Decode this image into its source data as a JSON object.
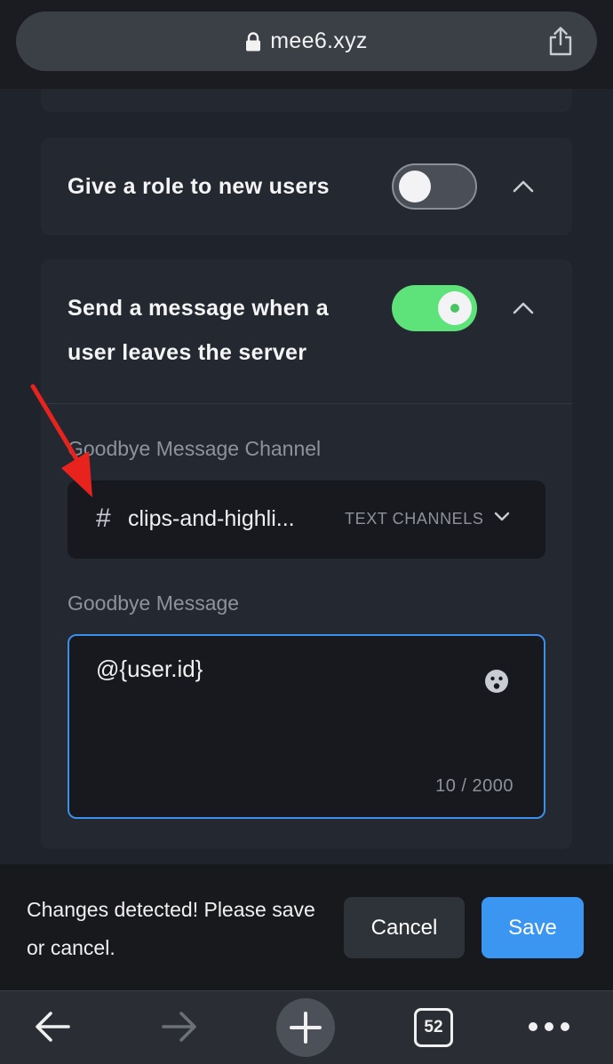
{
  "browser": {
    "url": "mee6.xyz",
    "tab_count": "52"
  },
  "role_card": {
    "title": "Give a role to new users",
    "toggle_on": false
  },
  "goodbye_card": {
    "title": "Send a message when a user leaves the server",
    "toggle_on": true,
    "channel_label": "Goodbye Message Channel",
    "channel_value": "clips-and-highli...",
    "channel_group": "TEXT CHANNELS",
    "message_label": "Goodbye Message",
    "message_value": "@{user.id}",
    "char_counter": "10 / 2000"
  },
  "save_bar": {
    "message": "Changes detected! Please save or cancel.",
    "cancel_label": "Cancel",
    "save_label": "Save"
  },
  "colors": {
    "accent_blue": "#3a96f0",
    "toggle_green": "#5ee27a",
    "annotation_red": "#e8231e"
  },
  "icons": {
    "lock": "lock-icon",
    "share": "share-icon",
    "chevron_up": "chevron-up-icon",
    "chevron_down": "chevron-down-icon",
    "hash": "hash-icon",
    "emoji": "emoji-icon",
    "back": "back-arrow-icon",
    "forward": "forward-arrow-icon",
    "new_tab": "plus-icon",
    "more": "more-dots-icon"
  }
}
